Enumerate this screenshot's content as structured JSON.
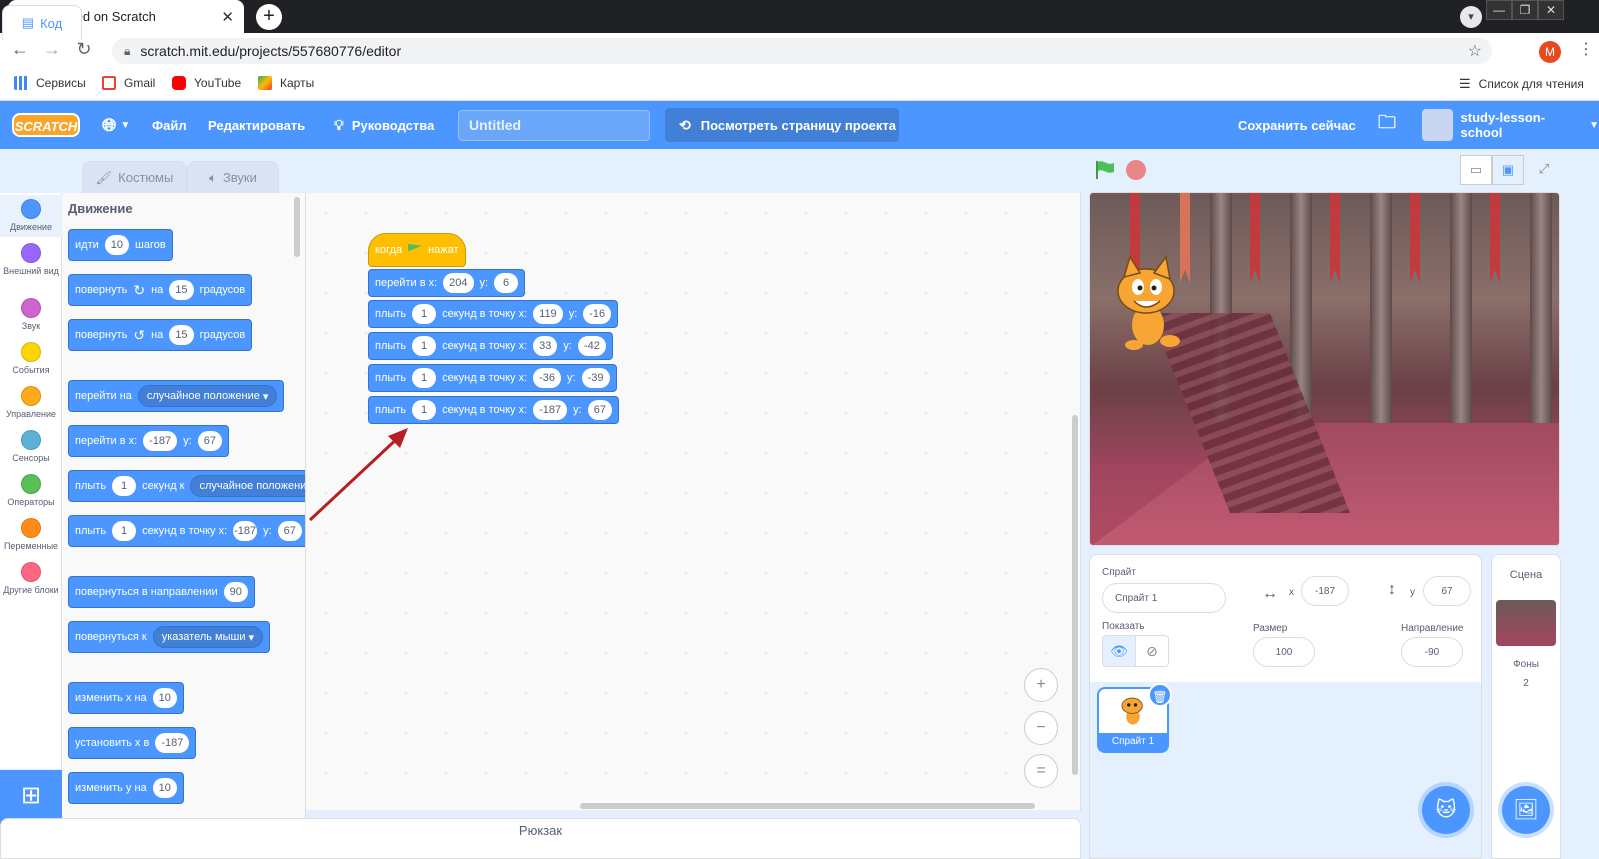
{
  "browser": {
    "tab_title": "Untitled on Scratch",
    "tab_close": "✕",
    "new_tab": "+",
    "url": "scratch.mit.edu/projects/557680776/editor",
    "profile_initial": "M",
    "bookmarks": [
      {
        "label": "Сервисы",
        "color": "#4285f4"
      },
      {
        "label": "Gmail",
        "color": "#ea4335"
      },
      {
        "label": "YouTube",
        "color": "#ff0000"
      },
      {
        "label": "Карты",
        "color": "#34a853"
      }
    ],
    "reading_list": "Список для чтения"
  },
  "menubar": {
    "logo": "SCRATCH",
    "file": "Файл",
    "edit": "Редактировать",
    "tutorials": "Руководства",
    "project_title": "Untitled",
    "see_project": "Посмотреть страницу проекта",
    "save_now": "Сохранить сейчас",
    "username": "study-lesson-school"
  },
  "tabs": {
    "code": "Код",
    "costumes": "Костюмы",
    "sounds": "Звуки"
  },
  "categories": [
    {
      "label": "Движение",
      "color": "#4c97ff"
    },
    {
      "label": "Внешний вид",
      "color": "#9966ff"
    },
    {
      "label": "Звук",
      "color": "#cf63cf"
    },
    {
      "label": "События",
      "color": "#ffd500"
    },
    {
      "label": "Управление",
      "color": "#ffab19"
    },
    {
      "label": "Сенсоры",
      "color": "#5cb1d6"
    },
    {
      "label": "Операторы",
      "color": "#59c059"
    },
    {
      "label": "Переменные",
      "color": "#ff8c1a"
    },
    {
      "label": "Другие блоки",
      "color": "#ff6680"
    }
  ],
  "palette": {
    "title": "Движение",
    "move": {
      "label": "идти",
      "value": "10",
      "suffix": "шагов"
    },
    "turn_right": {
      "label": "повернуть",
      "on": "на",
      "value": "15",
      "suffix": "градусов"
    },
    "turn_left": {
      "label": "повернуть",
      "on": "на",
      "value": "15",
      "suffix": "градусов"
    },
    "goto": {
      "label": "перейти на",
      "option": "случайное положение"
    },
    "goto_xy": {
      "label": "перейти в x:",
      "x": "-187",
      "ylabel": "y:",
      "y": "67"
    },
    "glide_to": {
      "label": "плыть",
      "value": "1",
      "mid": "секунд к",
      "option": "случайное положение"
    },
    "glide_xy": {
      "label": "плыть",
      "value": "1",
      "mid": "секунд в точку x:",
      "x": "-187",
      "ylabel": "y:",
      "y": "67"
    },
    "point_dir": {
      "label": "повернуться в направлении",
      "value": "90"
    },
    "point_to": {
      "label": "повернуться к",
      "option": "указатель мыши"
    },
    "change_x": {
      "label": "изменить x на",
      "value": "10"
    },
    "set_x": {
      "label": "установить x в",
      "value": "-187"
    },
    "change_y": {
      "label": "изменить y на",
      "value": "10"
    }
  },
  "script": {
    "hat": {
      "label": "когда",
      "suffix": "нажат"
    },
    "goto": {
      "label": "перейти в x:",
      "x": "204",
      "ylabel": "y:",
      "y": "6"
    },
    "glides": [
      {
        "label": "плыть",
        "secs": "1",
        "mid": "секунд в точку x:",
        "x": "119",
        "ylabel": "y:",
        "y": "-16"
      },
      {
        "label": "плыть",
        "secs": "1",
        "mid": "секунд в точку x:",
        "x": "33",
        "ylabel": "y:",
        "y": "-42"
      },
      {
        "label": "плыть",
        "secs": "1",
        "mid": "секунд в точку x:",
        "x": "-36",
        "ylabel": "y:",
        "y": "-39"
      },
      {
        "label": "плыть",
        "secs": "1",
        "mid": "секунд в точку x:",
        "x": "-187",
        "ylabel": "y:",
        "y": "67"
      }
    ]
  },
  "zoom": {
    "in": "+",
    "out": "−",
    "reset": "="
  },
  "backpack": "Рюкзак",
  "sprite": {
    "label": "Спрайт",
    "name": "Спрайт 1",
    "x_label": "x",
    "x": "-187",
    "y_label": "y",
    "y": "67",
    "show_label": "Показать",
    "size_label": "Размер",
    "size": "100",
    "direction_label": "Направление",
    "direction": "-90",
    "thumb_label": "Спрайт 1"
  },
  "stage_panel": {
    "title": "Сцена",
    "backdrops_label": "Фоны",
    "backdrops_count": "2"
  }
}
